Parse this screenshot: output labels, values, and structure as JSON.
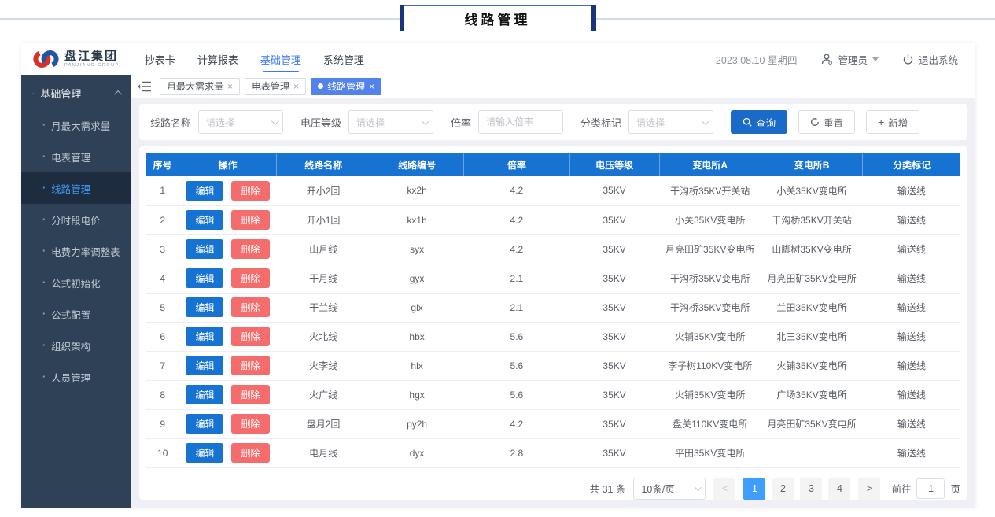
{
  "annotation": {
    "title": "线路管理"
  },
  "colors": {
    "primary": "#409eff",
    "header_blue": "#1673d2",
    "danger": "#f56c6c",
    "sidebar_bg": "#2f4156",
    "sidebar_active": "#1d2c3e",
    "tab_active": "#5382ec",
    "query_btn": "#1a6bc8",
    "nav_active": "#3a7bf0"
  },
  "header": {
    "logo_title": "盘江集团",
    "logo_subtitle": "PANJIANG GROUP",
    "nav": [
      {
        "label": "抄表卡",
        "active": false
      },
      {
        "label": "计算报表",
        "active": false
      },
      {
        "label": "基础管理",
        "active": true
      },
      {
        "label": "系统管理",
        "active": false
      }
    ],
    "date": "2023.08.10 星期四",
    "user": "管理员",
    "logout": "退出系统"
  },
  "sidebar": {
    "group": "基础管理",
    "items": [
      {
        "label": "月最大需求量",
        "active": false
      },
      {
        "label": "电表管理",
        "active": false
      },
      {
        "label": "线路管理",
        "active": true
      },
      {
        "label": "分时段电价",
        "active": false
      },
      {
        "label": "电费力率调整表",
        "active": false
      },
      {
        "label": "公式初始化",
        "active": false
      },
      {
        "label": "公式配置",
        "active": false
      },
      {
        "label": "组织架构",
        "active": false
      },
      {
        "label": "人员管理",
        "active": false
      }
    ]
  },
  "tabs": [
    {
      "label": "月最大需求量",
      "active": false
    },
    {
      "label": "电表管理",
      "active": false
    },
    {
      "label": "线路管理",
      "active": true
    }
  ],
  "filters": {
    "line_name": {
      "label": "线路名称",
      "placeholder": "请选择"
    },
    "voltage": {
      "label": "电压等级",
      "placeholder": "请选择"
    },
    "ratio": {
      "label": "倍率",
      "placeholder": "请输入倍率"
    },
    "category": {
      "label": "分类标记",
      "placeholder": "请选择"
    },
    "search_label": "查询",
    "reset_label": "重置",
    "add_label": "新增"
  },
  "table": {
    "columns": [
      "序号",
      "操作",
      "线路名称",
      "线路编号",
      "倍率",
      "电压等级",
      "变电所A",
      "变电所B",
      "分类标记"
    ],
    "actions": {
      "edit": "编辑",
      "delete": "删除"
    },
    "rows": [
      {
        "no": "1",
        "name": "开小2回",
        "code": "kx2h",
        "ratio": "4.2",
        "voltage": "35KV",
        "station_a": "干沟桥35KV开关站",
        "station_b": "小关35KV变电所",
        "category": "输送线"
      },
      {
        "no": "2",
        "name": "开小1回",
        "code": "kx1h",
        "ratio": "4.2",
        "voltage": "35KV",
        "station_a": "小关35KV变电所",
        "station_b": "干沟桥35KV开关站",
        "category": "输送线"
      },
      {
        "no": "3",
        "name": "山月线",
        "code": "syx",
        "ratio": "4.2",
        "voltage": "35KV",
        "station_a": "月亮田矿35KV变电所",
        "station_b": "山脚树35KV变电所",
        "category": "输送线"
      },
      {
        "no": "4",
        "name": "干月线",
        "code": "gyx",
        "ratio": "2.1",
        "voltage": "35KV",
        "station_a": "干沟桥35KV变电所",
        "station_b": "月亮田矿35KV变电所",
        "category": "输送线"
      },
      {
        "no": "5",
        "name": "干兰线",
        "code": "glx",
        "ratio": "2.1",
        "voltage": "35KV",
        "station_a": "干沟桥35KV变电所",
        "station_b": "兰田35KV变电所",
        "category": "输送线"
      },
      {
        "no": "6",
        "name": "火北线",
        "code": "hbx",
        "ratio": "5.6",
        "voltage": "35KV",
        "station_a": "火铺35KV变电所",
        "station_b": "北三35KV变电所",
        "category": "输送线"
      },
      {
        "no": "7",
        "name": "火李线",
        "code": "hlx",
        "ratio": "5.6",
        "voltage": "35KV",
        "station_a": "李子树110KV变电所",
        "station_b": "火铺35KV变电所",
        "category": "输送线"
      },
      {
        "no": "8",
        "name": "火广线",
        "code": "hgx",
        "ratio": "5.6",
        "voltage": "35KV",
        "station_a": "火铺35KV变电所",
        "station_b": "广场35KV变电所",
        "category": "输送线"
      },
      {
        "no": "9",
        "name": "盘月2回",
        "code": "py2h",
        "ratio": "4.2",
        "voltage": "35KV",
        "station_a": "盘关110KV变电所",
        "station_b": "月亮田矿35KV变电所",
        "category": "输送线"
      },
      {
        "no": "10",
        "name": "电月线",
        "code": "dyx",
        "ratio": "2.8",
        "voltage": "35KV",
        "station_a": "平田35KV变电所",
        "station_b": "",
        "category": "输送线"
      }
    ]
  },
  "pagination": {
    "total": "共 31 条",
    "page_size": "10条/页",
    "pages": [
      "1",
      "2",
      "3",
      "4"
    ],
    "active_page": "1",
    "prev": "<",
    "next": ">",
    "goto_label": "前往",
    "goto_value": "1",
    "goto_suffix": "页"
  }
}
